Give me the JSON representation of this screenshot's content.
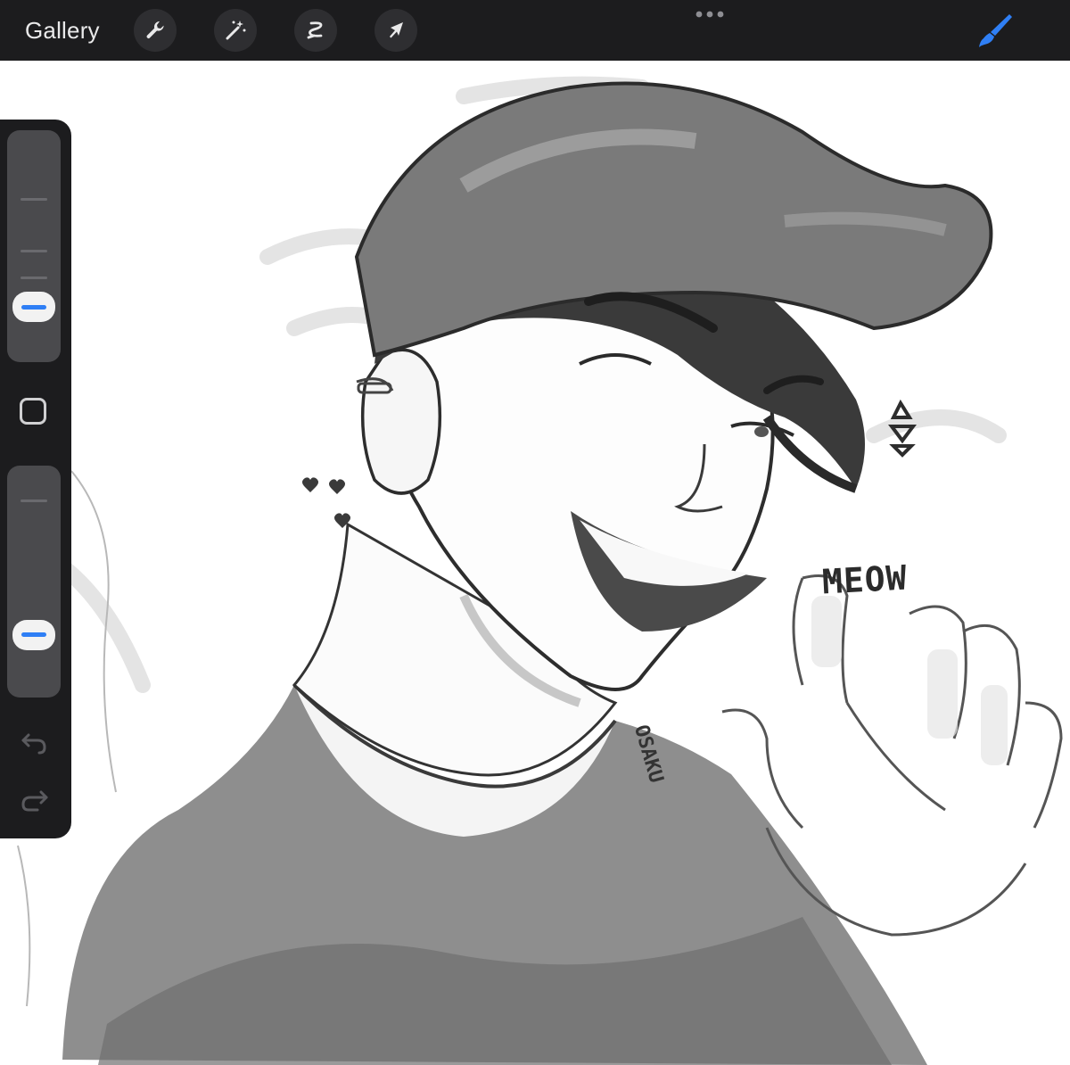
{
  "topbar": {
    "gallery_label": "Gallery",
    "tools": [
      {
        "name": "wrench-icon",
        "label": "Actions"
      },
      {
        "name": "magic-wand-icon",
        "label": "Adjustments"
      },
      {
        "name": "selection-icon",
        "label": "Selection"
      },
      {
        "name": "arrow-cursor-icon",
        "label": "Transform"
      }
    ],
    "more_icon": "ellipsis-icon",
    "brush_icon": "brush-icon",
    "brush_color": "#2f7ff5"
  },
  "sidebar": {
    "brush_size_level": 0.18,
    "opacity_level": 0.22,
    "modify_icon": "square-icon",
    "undo_icon": "undo-icon",
    "redo_icon": "redo-icon",
    "accent_color": "#2f7ff5"
  },
  "canvas": {
    "meow_text": "MEOW",
    "signature_text": "OSAKU"
  }
}
